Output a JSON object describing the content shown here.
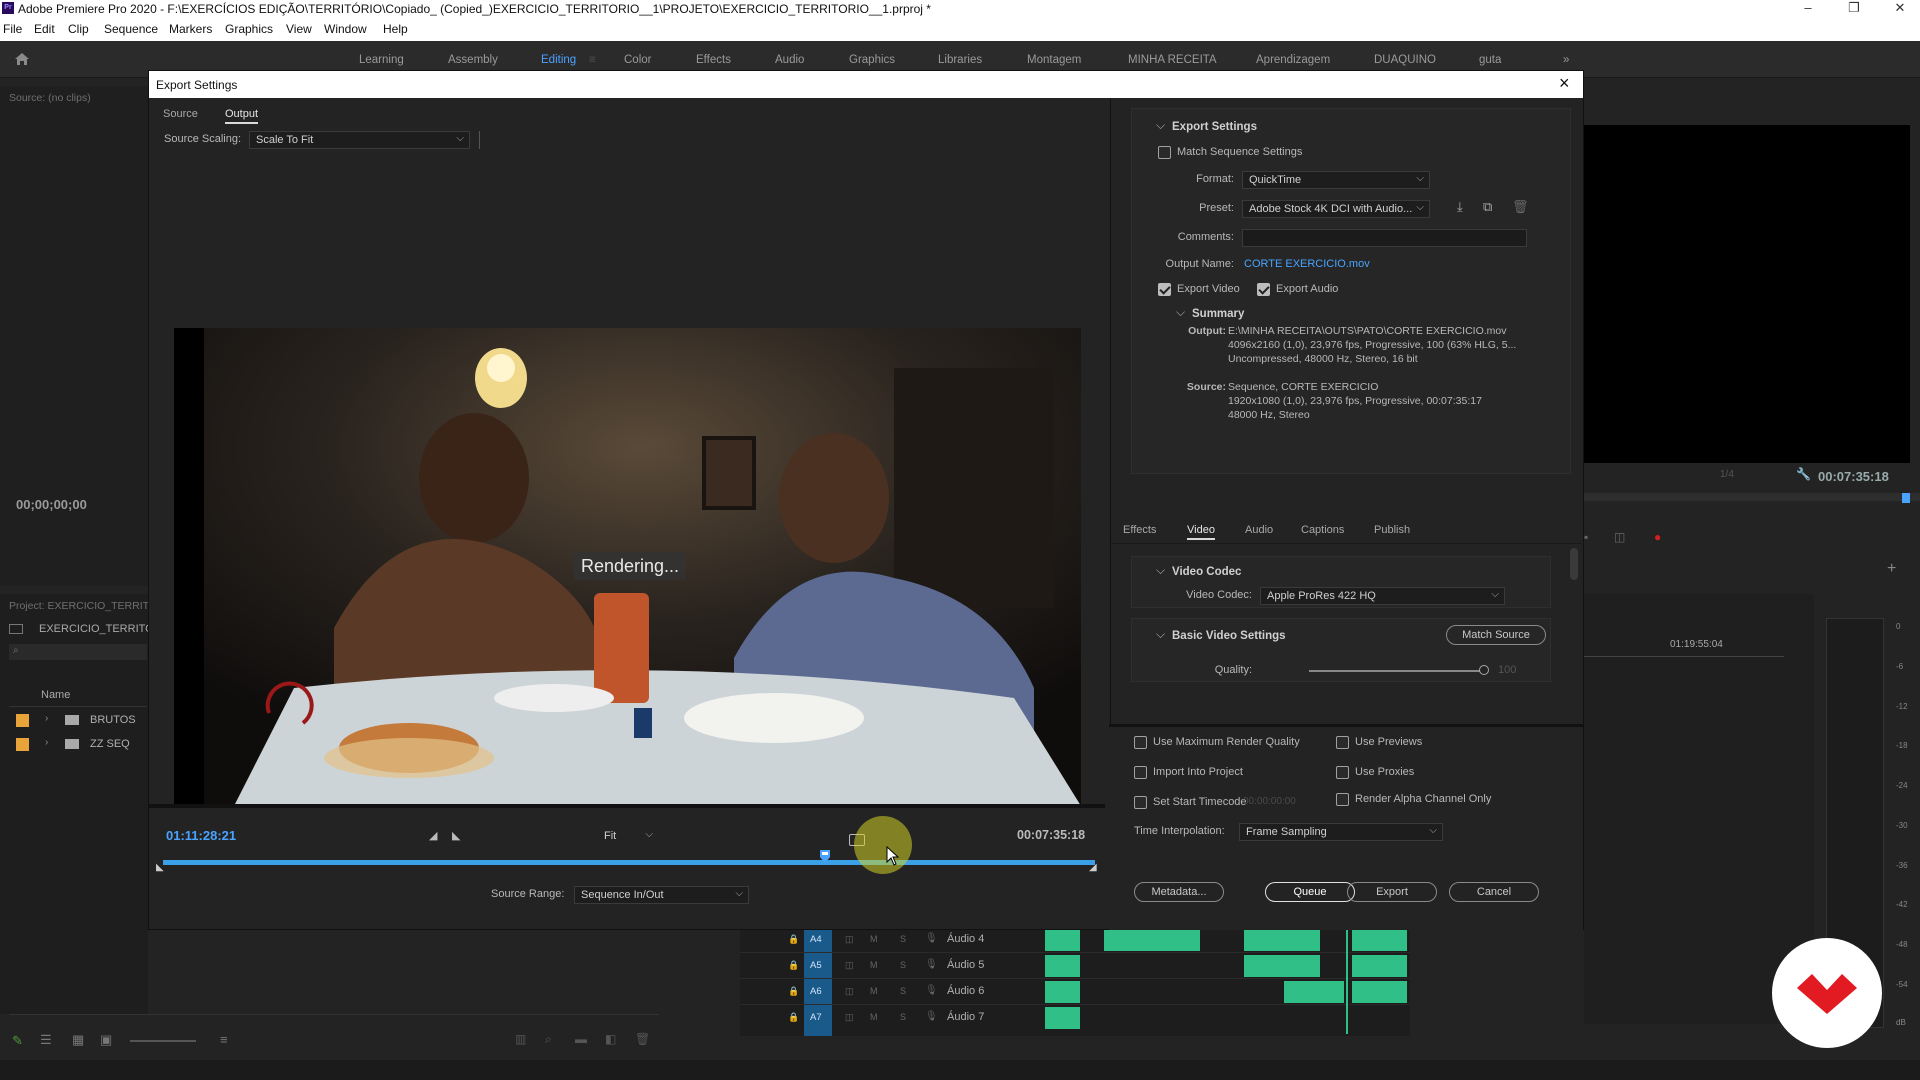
{
  "titlebar": {
    "app_title": "Adobe Premiere Pro 2020 - F:\\EXERCÍCIOS EDIÇÃO\\TERRITÓRIO\\Copiado_ (Copied_)EXERCICIO_TERRITORIO__1\\PROJETO\\EXERCICIO_TERRITORIO__1.prproj *"
  },
  "menu": [
    "File",
    "Edit",
    "Clip",
    "Sequence",
    "Markers",
    "Graphics",
    "View",
    "Window",
    "Help"
  ],
  "workspaces": {
    "items": [
      "Learning",
      "Assembly",
      "Editing",
      "Color",
      "Effects",
      "Audio",
      "Graphics",
      "Libraries",
      "Montagem",
      "MINHA RECEITA",
      "Aprendizagem",
      "DUAQUINO",
      "guta"
    ],
    "active": "Editing",
    "overflow": "»"
  },
  "background": {
    "source_panel_label": "Source: (no clips)",
    "source_timecode": "00;00;00;00",
    "project_panel_label": "Project: EXERCICIO_TERRITO",
    "project_name": "EXERCICIO_TERRITOR",
    "name_header": "Name",
    "bins": [
      {
        "name": "BRUTOS",
        "color": "#e8a33a"
      },
      {
        "name": "ZZ SEQ",
        "color": "#e8a33a"
      }
    ],
    "program_fraction": "1/4",
    "program_timecode": "00:07:35:18",
    "timeline_timecode": "01:19:55:04",
    "tracks": [
      {
        "id": "A4",
        "name": "Áudio 4"
      },
      {
        "id": "A5",
        "name": "Áudio 5"
      },
      {
        "id": "A6",
        "name": "Áudio 6"
      },
      {
        "id": "A7",
        "name": "Áudio 7"
      }
    ],
    "meter_scale": [
      "0",
      "-6",
      "-12",
      "-18",
      "-24",
      "-30",
      "-36",
      "-42",
      "-48",
      "-54",
      "dB"
    ],
    "track_m": "M",
    "track_s": "S"
  },
  "dialog": {
    "title": "Export Settings",
    "close": "×",
    "tabs": [
      "Source",
      "Output"
    ],
    "active_tab": "Output",
    "source_scaling_label": "Source Scaling:",
    "source_scaling_value": "Scale To Fit",
    "preview_overlay": "Rendering...",
    "current_timecode": "01:11:28:21",
    "fit_value": "Fit",
    "duration_timecode": "00:07:35:18",
    "playhead_fraction": 0.71,
    "source_range_label": "Source Range:",
    "source_range_value": "Sequence In/Out",
    "export_settings": {
      "header": "Export Settings",
      "match_sequence": "Match Sequence Settings",
      "format_label": "Format:",
      "format_value": "QuickTime",
      "preset_label": "Preset:",
      "preset_value": "Adobe Stock 4K DCI with Audio...",
      "comments_label": "Comments:",
      "comments_value": "",
      "output_name_label": "Output Name:",
      "output_name_value": "CORTE EXERCICIO.mov",
      "export_video": "Export Video",
      "export_audio": "Export Audio",
      "summary_header": "Summary",
      "output_label": "Output:",
      "output_lines": [
        "E:\\MINHA RECEITA\\OUTS\\PATO\\CORTE EXERCICIO.mov",
        "4096x2160 (1,0), 23,976 fps, Progressive, 100 (63% HLG, 5...",
        "Uncompressed, 48000 Hz, Stereo, 16 bit"
      ],
      "source_label": "Source:",
      "source_lines": [
        "Sequence, CORTE EXERCICIO",
        "1920x1080 (1,0), 23,976 fps, Progressive, 00:07:35:17",
        "48000 Hz, Stereo"
      ]
    },
    "settings_tabs": [
      "Effects",
      "Video",
      "Audio",
      "Captions",
      "Publish"
    ],
    "active_settings_tab": "Video",
    "video_codec_header": "Video Codec",
    "video_codec_label": "Video Codec:",
    "video_codec_value": "Apple ProRes 422 HQ",
    "basic_video_header": "Basic Video Settings",
    "match_source": "Match Source",
    "quality_label": "Quality:",
    "quality_value": "100",
    "quality_level": 1.0,
    "options": {
      "max_render": "Use Maximum Render Quality",
      "use_previews": "Use Previews",
      "import_project": "Import Into Project",
      "use_proxies": "Use Proxies",
      "set_start_tc": "Set Start Timecode",
      "start_tc_value": "00:00:00:00",
      "render_alpha": "Render Alpha Channel Only"
    },
    "time_interp_label": "Time Interpolation:",
    "time_interp_value": "Frame Sampling",
    "buttons": {
      "metadata": "Metadata...",
      "queue": "Queue",
      "export": "Export",
      "cancel": "Cancel"
    }
  },
  "colors": {
    "accent": "#4aa3ff",
    "audio_clip": "#2fbf87",
    "logo_red": "#e21b23"
  }
}
